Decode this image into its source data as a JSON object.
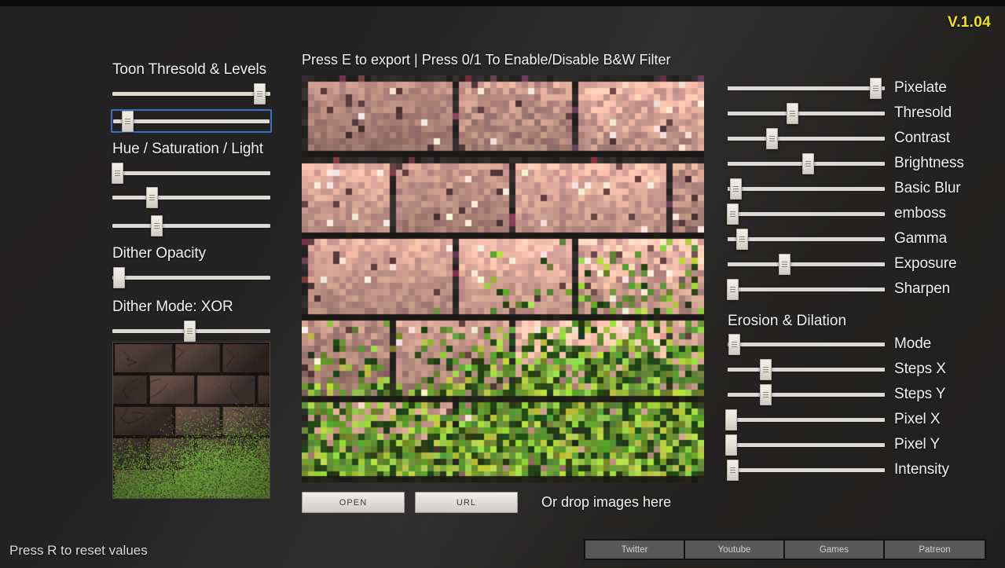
{
  "app": {
    "version_label": "V.1.04",
    "accent_version_color": "#f2e21c",
    "background_color": "#242322",
    "slider_track_color": "#ded9d2"
  },
  "header": {
    "hint": "Press E to export | Press 0/1 To Enable/Disable B&W Filter"
  },
  "left_panel": {
    "section_toon": {
      "title": "Toon Thresold & Levels",
      "sliders": [
        {
          "name": "toon-threshold-slider",
          "value_pct": 93,
          "focused": false
        },
        {
          "name": "toon-levels-slider",
          "value_pct": 9,
          "focused": true
        }
      ]
    },
    "section_hsl": {
      "title": "Hue / Saturation / Light",
      "sliders": [
        {
          "name": "hue-slider",
          "value_pct": 3
        },
        {
          "name": "saturation-slider",
          "value_pct": 25
        },
        {
          "name": "light-slider",
          "value_pct": 28
        }
      ]
    },
    "section_dither_opacity": {
      "title": "Dither Opacity",
      "sliders": [
        {
          "name": "dither-opacity-slider",
          "value_pct": 4
        }
      ]
    },
    "section_dither_mode": {
      "title": "Dither Mode: XOR",
      "sliders": [
        {
          "name": "dither-mode-slider",
          "value_pct": 49
        }
      ]
    },
    "thumbnail_name": "source-image-thumbnail"
  },
  "right_panel": {
    "filters": [
      {
        "label": "Pixelate",
        "name": "pixelate-slider",
        "value_pct": 94
      },
      {
        "label": "Thresold",
        "name": "thresold-slider",
        "value_pct": 41
      },
      {
        "label": "Contrast",
        "name": "contrast-slider",
        "value_pct": 28
      },
      {
        "label": "Brightness",
        "name": "brightness-slider",
        "value_pct": 51
      },
      {
        "label": "Basic Blur",
        "name": "basic-blur-slider",
        "value_pct": 5
      },
      {
        "label": "emboss",
        "name": "emboss-slider",
        "value_pct": 3
      },
      {
        "label": "Gamma",
        "name": "gamma-slider",
        "value_pct": 9
      },
      {
        "label": "Exposure",
        "name": "exposure-slider",
        "value_pct": 36
      },
      {
        "label": "Sharpen",
        "name": "sharpen-slider",
        "value_pct": 3
      }
    ],
    "erosion_group_title": "Erosion & Dilation",
    "erosion": [
      {
        "label": "Mode",
        "name": "mode-slider",
        "value_pct": 4
      },
      {
        "label": "Steps X",
        "name": "steps-x-slider",
        "value_pct": 24
      },
      {
        "label": "Steps Y",
        "name": "steps-y-slider",
        "value_pct": 24
      },
      {
        "label": "Pixel X",
        "name": "pixel-x-slider",
        "value_pct": 2
      },
      {
        "label": "Pixel Y",
        "name": "pixel-y-slider",
        "value_pct": 2
      },
      {
        "label": "Intensity",
        "name": "intensity-slider",
        "value_pct": 3
      }
    ]
  },
  "actions": {
    "open_label": "OPEN",
    "url_label": "URL",
    "drop_hint": "Or drop images here"
  },
  "footer": {
    "reset_hint": "Press R to reset values",
    "social": [
      {
        "label": "Twitter",
        "name": "social-twitter-button"
      },
      {
        "label": "Youtube",
        "name": "social-youtube-button"
      },
      {
        "label": "Games",
        "name": "social-games-button"
      },
      {
        "label": "Patreon",
        "name": "social-patreon-button"
      }
    ]
  }
}
